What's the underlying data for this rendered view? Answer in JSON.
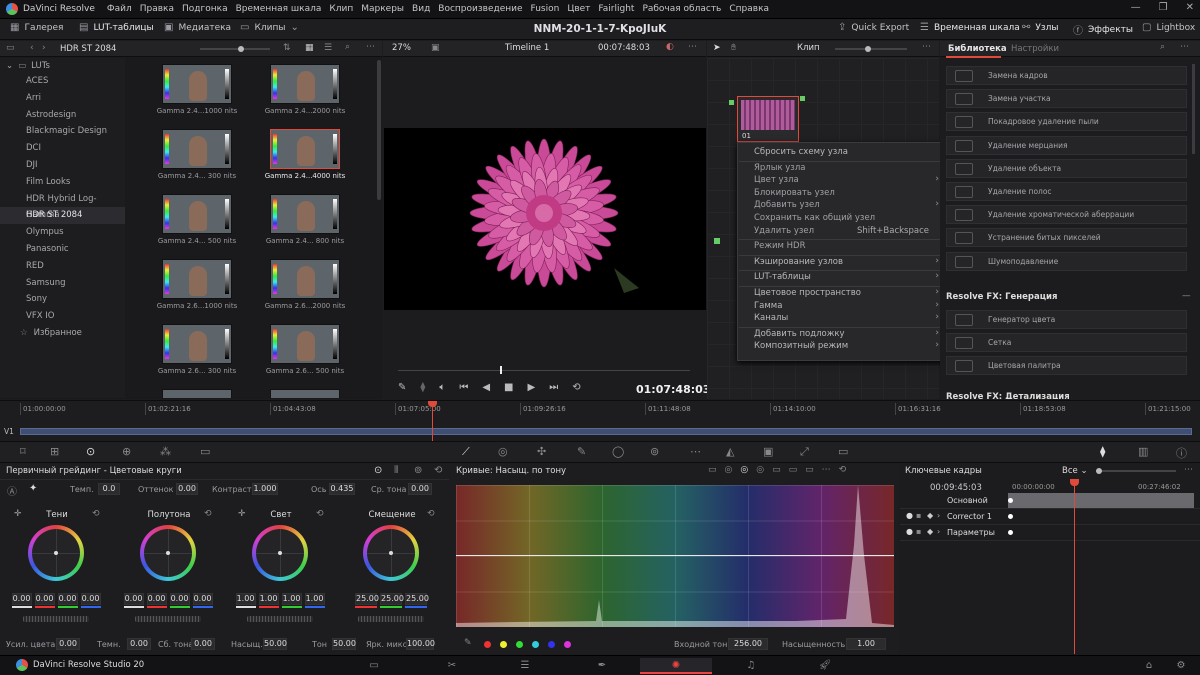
{
  "menu": {
    "app": "DaVinci Resolve",
    "items": [
      "Файл",
      "Правка",
      "Подгонка",
      "Временная шкала",
      "Клип",
      "Маркеры",
      "Вид",
      "Воспроизведение",
      "Fusion",
      "Цвет",
      "Fairlight",
      "Рабочая область",
      "Справка"
    ]
  },
  "toolbar": {
    "gallery": "Галерея",
    "luts": "LUT-таблицы",
    "media": "Медиатека",
    "clips": "Клипы",
    "project": "NNM-20-1-1-7-KpoJIuK",
    "quick_export": "Quick Export",
    "timeline_btn": "Временная шкала",
    "nodes": "Узлы",
    "effects": "Эффекты",
    "lightbox": "Lightbox"
  },
  "lut_panel": {
    "header": "HDR ST 2084",
    "root": "LUTs",
    "items": [
      "ACES",
      "Arri",
      "Astrodesign",
      "Blackmagic Design",
      "DCI",
      "DJI",
      "Film Looks",
      "HDR Hybrid Log-Gamma",
      "HDR ST 2084",
      "Olympus",
      "Panasonic",
      "RED",
      "Samsung",
      "Sony",
      "VFX IO"
    ],
    "selected": "HDR ST 2084",
    "favorites": "Избранное"
  },
  "thumbs": [
    "Gamma 2.4...1000 nits",
    "Gamma 2.4...2000 nits",
    "Gamma 2.4... 300 nits",
    "Gamma 2.4...4000 nits",
    "Gamma 2.4... 500 nits",
    "Gamma 2.4... 800 nits",
    "Gamma 2.6...1000 nits",
    "Gamma 2.6...2000 nits",
    "Gamma 2.6... 300 nits",
    "Gamma 2.6... 500 nits"
  ],
  "viewer": {
    "zoom": "27%",
    "timeline": "Timeline 1",
    "timecode": "00:07:48:03",
    "big_timecode": "01:07:48:03"
  },
  "node_editor": {
    "mode": "Клип",
    "node_label": "01"
  },
  "context_menu": {
    "items": [
      {
        "label": "Сбросить схему узла",
        "dim": false,
        "arrow": false,
        "shortcut": ""
      },
      {
        "label": "Ярлык узла",
        "dim": true,
        "arrow": false,
        "shortcut": ""
      },
      {
        "label": "Цвет узла",
        "dim": true,
        "arrow": true,
        "shortcut": ""
      },
      {
        "label": "Блокировать узел",
        "dim": true,
        "arrow": false,
        "shortcut": ""
      },
      {
        "label": "Добавить узел",
        "dim": true,
        "arrow": true,
        "shortcut": ""
      },
      {
        "label": "Сохранить как общий узел",
        "dim": true,
        "arrow": false,
        "shortcut": ""
      },
      {
        "label": "Удалить узел",
        "dim": true,
        "arrow": false,
        "shortcut": "Shift+Backspace"
      },
      {
        "label": "Режим HDR",
        "dim": true,
        "arrow": false,
        "shortcut": ""
      },
      {
        "label": "Кэширование узлов",
        "dim": false,
        "arrow": true,
        "shortcut": ""
      },
      {
        "label": "LUT-таблицы",
        "dim": false,
        "arrow": true,
        "shortcut": ""
      },
      {
        "label": "Цветовое пространство",
        "dim": false,
        "arrow": true,
        "shortcut": ""
      },
      {
        "label": "Гамма",
        "dim": false,
        "arrow": true,
        "shortcut": ""
      },
      {
        "label": "Каналы",
        "dim": false,
        "arrow": true,
        "shortcut": ""
      },
      {
        "label": "Добавить подложку",
        "dim": false,
        "arrow": true,
        "shortcut": ""
      },
      {
        "label": "Композитный режим",
        "dim": false,
        "arrow": true,
        "shortcut": ""
      }
    ]
  },
  "library": {
    "tab_library": "Библиотека",
    "tab_settings": "Настройки",
    "items1": [
      "Замена кадров",
      "Замена участка",
      "Покадровое удаление пыли",
      "Удаление мерцания",
      "Удаление объекта",
      "Удаление полос",
      "Удаление хроматической аберрации",
      "Устранение битых пикселей",
      "Шумоподавление"
    ],
    "section": "Resolve FX: Генерация",
    "items2": [
      "Генератор цвета",
      "Сетка",
      "Цветовая палитра"
    ],
    "section2": "Resolve FX: Детализация"
  },
  "timeline": {
    "ticks": [
      "01:00:00:00",
      "01:02:21:16",
      "01:04:43:08",
      "01:07:05:00",
      "01:09:26:16",
      "01:11:48:08",
      "01:14:10:00",
      "01:16:31:16",
      "01:18:53:08",
      "01:21:15:00"
    ],
    "track": "V1"
  },
  "primary": {
    "title": "Первичный грейдинг - Цветовые круги",
    "temp_l": "Темп.",
    "temp": "0.0",
    "tint_l": "Оттенок",
    "tint": "0.00",
    "contrast_l": "Контраст",
    "contrast": "1.000",
    "pivot_l": "Ось",
    "pivot": "0.435",
    "mid_l": "Ср. тона",
    "mid": "0.00",
    "wheels": [
      {
        "name": "Тени",
        "vals": [
          "0.00",
          "0.00",
          "0.00",
          "0.00"
        ]
      },
      {
        "name": "Полутона",
        "vals": [
          "0.00",
          "0.00",
          "0.00",
          "0.00"
        ]
      },
      {
        "name": "Свет",
        "vals": [
          "1.00",
          "1.00",
          "1.00",
          "1.00"
        ]
      },
      {
        "name": "Смещение",
        "vals": [
          "25.00",
          "25.00",
          "25.00"
        ]
      }
    ],
    "bottom": [
      {
        "l": "Усил. цвета",
        "v": "0.00"
      },
      {
        "l": "Темн.",
        "v": "0.00"
      },
      {
        "l": "Сб. тона",
        "v": "0.00"
      },
      {
        "l": "Насыщ.",
        "v": "50.00"
      },
      {
        "l": "Тон",
        "v": "50.00"
      },
      {
        "l": "Ярк. микс",
        "v": "100.00"
      }
    ]
  },
  "curves": {
    "title": "Кривые: Насыщ. по тону",
    "input_l": "Входной тон",
    "input": "256.00",
    "sat_l": "Насыщенность",
    "sat": "1.00"
  },
  "keyframes": {
    "title": "Ключевые кадры",
    "filter": "Все",
    "timecode": "00:09:45:03",
    "t0": "00:00:00:00",
    "t1": "00:27:46:02",
    "rows": [
      "Основной",
      "Corrector 1",
      "Параметры"
    ]
  },
  "footer": {
    "app": "DaVinci Resolve Studio 20"
  },
  "colors": {
    "accent": "#e0463a",
    "bg": "#1c1c1e"
  }
}
